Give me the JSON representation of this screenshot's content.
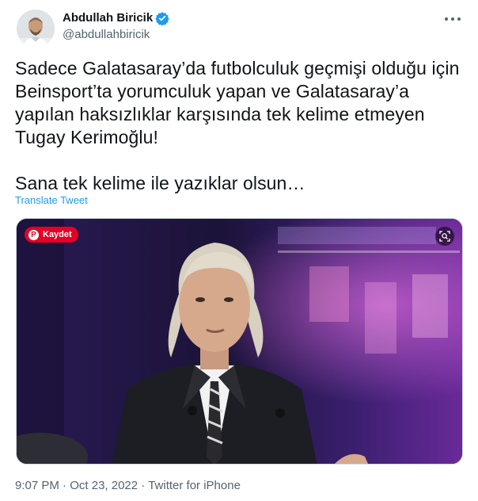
{
  "author": {
    "display_name": "Abdullah Biricik",
    "handle": "@abdullahbiricik",
    "verified": true,
    "avatar_icon": "profile-photo"
  },
  "menu": {
    "icon": "more-horizontal-icon"
  },
  "tweet": {
    "text": "Sadece Galatasaray’da futbolculuk geçmişi olduğu için\nBeinsport’ta yorumculuk yapan ve Galatasaray’a\nyapılan haksızlıklar karşısında tek kelime etmeyen\nTugay Kerimoğlu!\n\nSana tek kelime ile yazıklar olsun…",
    "translate_label": "Translate Tweet"
  },
  "media": {
    "save_label": "Kaydet",
    "save_icon": "pinterest-icon",
    "lens_icon": "visual-search-icon"
  },
  "meta": {
    "time": "9:07 PM",
    "separator1": " · ",
    "date": "Oct 23, 2022",
    "separator2": " · ",
    "source": "Twitter for iPhone"
  },
  "colors": {
    "accent": "#1d9bf0",
    "text": "#0f1419",
    "muted": "#536471",
    "pinterest": "#e60023"
  }
}
